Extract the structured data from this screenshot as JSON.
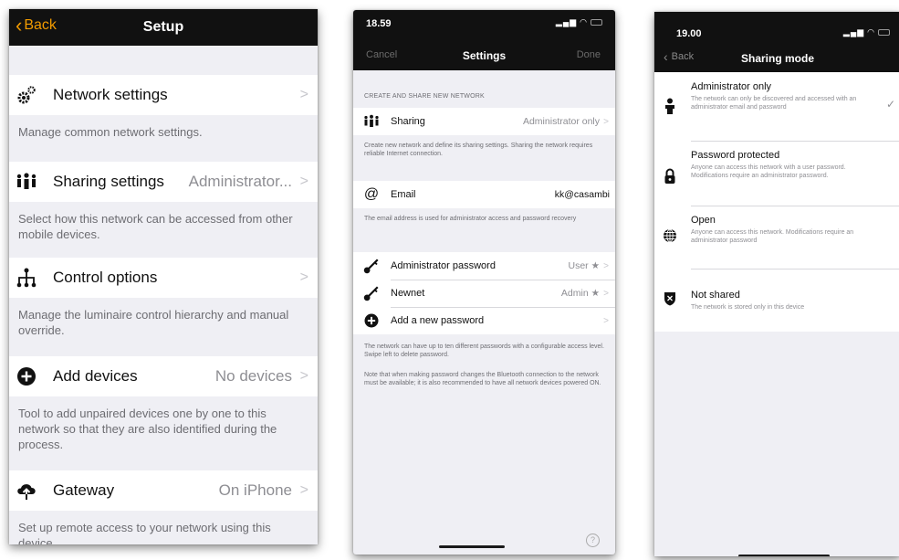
{
  "colors": {
    "accent": "#f29b00",
    "navbar": "#111111",
    "background": "#efeff4"
  },
  "setup": {
    "back_label": "Back",
    "title": "Setup",
    "rows": [
      {
        "label": "Network settings",
        "value": "",
        "icon": "gears-icon",
        "description": "Manage common network settings."
      },
      {
        "label": "Sharing settings",
        "value": "Administrator...",
        "icon": "people-sharing-icon",
        "description": "Select how this network can be accessed from other mobile devices."
      },
      {
        "label": "Control options",
        "value": "",
        "icon": "hierarchy-icon",
        "description": "Manage the luminaire control hierarchy and manual override."
      },
      {
        "label": "Add devices",
        "value": "No devices",
        "icon": "add-circle-icon",
        "description": "Tool to add unpaired devices one by one to this network so that they are also identified during the process."
      },
      {
        "label": "Gateway",
        "value": "On iPhone",
        "icon": "cloud-upload-icon",
        "description": "Set up remote access to your network using this device."
      }
    ]
  },
  "settings": {
    "time": "18.59",
    "cancel_label": "Cancel",
    "title": "Settings",
    "done_label": "Done",
    "section_header": "CREATE AND SHARE NEW NETWORK",
    "sharing": {
      "label": "Sharing",
      "value": "Administrator only"
    },
    "sharing_desc": "Create new network and define its sharing settings. Sharing the network requires reliable Internet connection.",
    "email": {
      "label": "Email",
      "value": "kk@casambi"
    },
    "email_desc": "The email address is used for administrator access and password recovery",
    "passwords": [
      {
        "label": "Administrator password",
        "value": "User ★"
      },
      {
        "label": "Newnet",
        "value": "Admin ★"
      }
    ],
    "add_password_label": "Add a new password",
    "password_desc_1": "The network can have up to ten different passwords with a configurable access level. Swipe left to delete password.",
    "password_desc_2": "Note that when making password changes the Bluetooth connection to the network must be available; it is also recommended to have all network devices powered ON.",
    "help_label": "?"
  },
  "sharing_mode": {
    "time": "19.00",
    "back_label": "Back",
    "title": "Sharing mode",
    "options": [
      {
        "title": "Administrator only",
        "icon": "person-icon",
        "selected": true,
        "description": "The network can only be discovered and accessed with an administrator email and password"
      },
      {
        "title": "Password protected",
        "icon": "lock-icon",
        "selected": false,
        "description": "Anyone can access this network with a user password. Modifications require an administrator password."
      },
      {
        "title": "Open",
        "icon": "globe-icon",
        "selected": false,
        "description": "Anyone can access this network. Modifications require an administrator password"
      },
      {
        "title": "Not shared",
        "icon": "shield-x-icon",
        "selected": false,
        "description": "The network is stored only in this device"
      }
    ]
  }
}
